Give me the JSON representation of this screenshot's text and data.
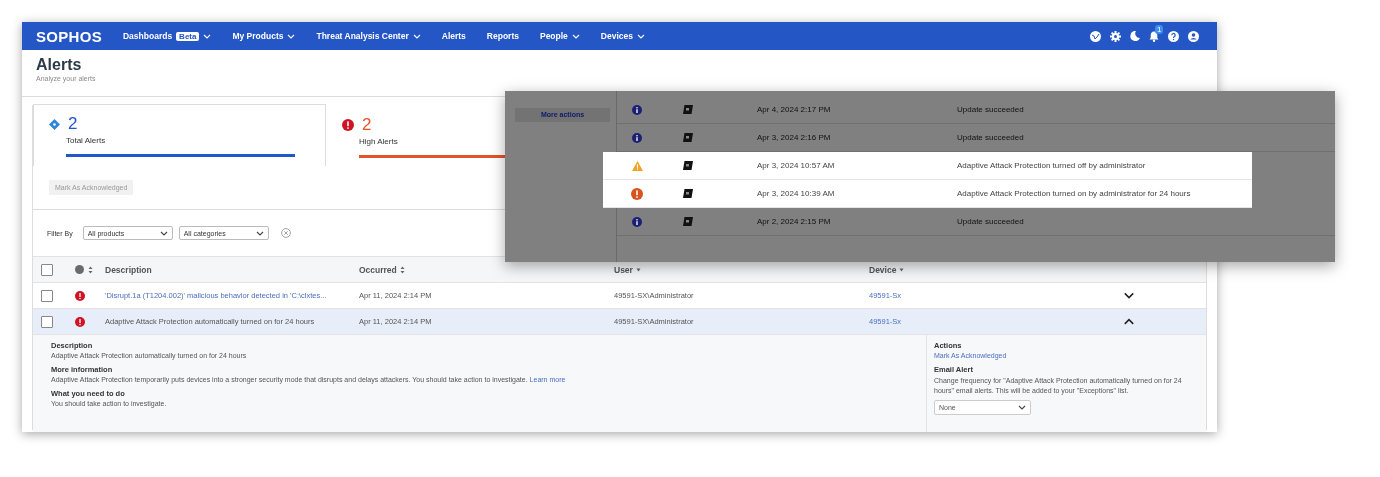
{
  "navbar": {
    "logo": "SOPHOS",
    "items": [
      {
        "label": "Dashboards",
        "badge": "Beta",
        "dropdown": true
      },
      {
        "label": "My Products",
        "dropdown": true
      },
      {
        "label": "Threat Analysis Center",
        "dropdown": true
      },
      {
        "label": "Alerts",
        "dropdown": false
      },
      {
        "label": "Reports",
        "dropdown": false
      },
      {
        "label": "People",
        "dropdown": true
      },
      {
        "label": "Devices",
        "dropdown": true
      }
    ],
    "notification_count": "1"
  },
  "page": {
    "title": "Alerts",
    "subtitle": "Analyze your alerts"
  },
  "tabs": [
    {
      "kind": "total",
      "count": "2",
      "label": "Total Alerts",
      "color": "#2057c9",
      "selected": true
    },
    {
      "kind": "high",
      "count": "2",
      "label": "High Alerts",
      "color": "#e2542a",
      "selected": false
    }
  ],
  "acknowledge_button": {
    "label": "Mark As Acknowledged",
    "disabled": true
  },
  "filter": {
    "label": "Filter By",
    "selects": [
      {
        "value": "All products"
      },
      {
        "value": "All categories"
      }
    ]
  },
  "table": {
    "header_checked": false,
    "columns": [
      {
        "label": "Description",
        "kind": "plain"
      },
      {
        "label": "Occurred",
        "kind": "sortable"
      },
      {
        "label": "User",
        "kind": "filter"
      },
      {
        "label": "Device",
        "kind": "filter"
      }
    ],
    "rows": [
      {
        "checked": false,
        "kind": "high",
        "description": "'Disrupt.1a (T1204.002)' malicious behavior detected in 'C:\\clxtes...",
        "link": true,
        "occurred": "Apr 11, 2024 2:14 PM",
        "user": "49591-SX\\Administrator",
        "device": "49591-Sx",
        "expanded": false
      },
      {
        "checked": false,
        "kind": "high",
        "description": "Adaptive Attack Protection automatically turned on for 24 hours",
        "link": false,
        "occurred": "Apr 11, 2024 2:14 PM",
        "user": "49591-SX\\Administrator",
        "device": "49591-Sx",
        "expanded": true
      }
    ]
  },
  "details": {
    "sections": [
      {
        "heading": "Description",
        "text": "Adaptive Attack Protection automatically turned on for 24 hours"
      },
      {
        "heading": "More information",
        "text": "Adaptive Attack Protection temporarily puts devices into a stronger security mode that disrupts and delays attackers. You should take action to investigate.",
        "link": "Learn more"
      },
      {
        "heading": "What you need to do",
        "text": "You should take action to investigate."
      }
    ],
    "actions": {
      "heading": "Actions",
      "link": "Mark As Acknowledged",
      "email_heading": "Email Alert",
      "email_text": "Change frequency for \"Adaptive Attack Protection automatically turned on for 24 hours\" email alerts. This will be added to your \"Exceptions\" list.",
      "frequency": "None"
    }
  },
  "overlay": {
    "button": "More actions",
    "events": [
      {
        "kind": "info",
        "date": "Apr 4, 2024 2:17 PM",
        "message": "Update succeeded",
        "highlighted": false
      },
      {
        "kind": "info",
        "date": "Apr 3, 2024 2:16 PM",
        "message": "Update succeeded",
        "highlighted": false
      },
      {
        "kind": "warning",
        "date": "Apr 3, 2024 10:57 AM",
        "message": "Adaptive Attack Protection turned off by administrator",
        "highlighted": true
      },
      {
        "kind": "high",
        "date": "Apr 3, 2024 10:39 AM",
        "message": "Adaptive Attack Protection turned on by administrator for 24 hours",
        "highlighted": true
      },
      {
        "kind": "info",
        "date": "Apr 2, 2024 2:15 PM",
        "message": "Update succeeded",
        "highlighted": false
      }
    ]
  }
}
